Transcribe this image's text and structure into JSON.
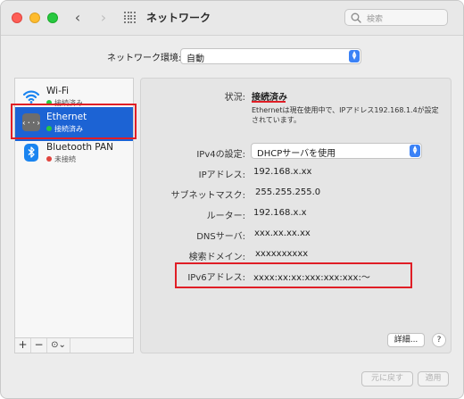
{
  "window": {
    "title": "ネットワーク",
    "search_placeholder": "検索"
  },
  "location": {
    "label": "ネットワーク環境:",
    "value": "自動"
  },
  "sidebar": {
    "items": [
      {
        "name": "Wi-Fi",
        "status": "接続済み",
        "status_color": "#28c840",
        "icon": "wifi-icon"
      },
      {
        "name": "Ethernet",
        "status": "接続済み",
        "status_color": "#28c840",
        "icon": "ethernet-icon",
        "selected": true
      },
      {
        "name": "Bluetooth PAN",
        "status": "未接続",
        "status_color": "#e0443e",
        "icon": "bluetooth-icon"
      }
    ],
    "add_label": "+",
    "remove_label": "−",
    "action_label": "⊙⌄"
  },
  "detail": {
    "status_label": "状況:",
    "status_value": "接続済み",
    "status_desc": "Ethernetは現在使用中で、IPアドレス192.168.1.4が設定されています。",
    "ipv4_label": "IPv4の設定:",
    "ipv4_value": "DHCPサーバを使用",
    "ip_label": "IPアドレス:",
    "ip_value": "192.168.x.xx",
    "subnet_label": "サブネットマスク:",
    "subnet_value": "255.255.255.0",
    "router_label": "ルーター:",
    "router_value": "192.168.x.x",
    "dns_label": "DNSサーバ:",
    "dns_value": "xxx.xx.xx.xx",
    "search_domain_label": "検索ドメイン:",
    "search_domain_value": "xxxxxxxxxx",
    "ipv6_label": "IPv6アドレス:",
    "ipv6_value": "xxxx:xx:xx:xxx:xxx:xxx:〜",
    "advanced_label": "詳細...",
    "help_label": "?"
  },
  "footer": {
    "revert_label": "元に戻す",
    "apply_label": "適用"
  },
  "colors": {
    "accent": "#1c63d4",
    "annotation": "#e01e26"
  }
}
